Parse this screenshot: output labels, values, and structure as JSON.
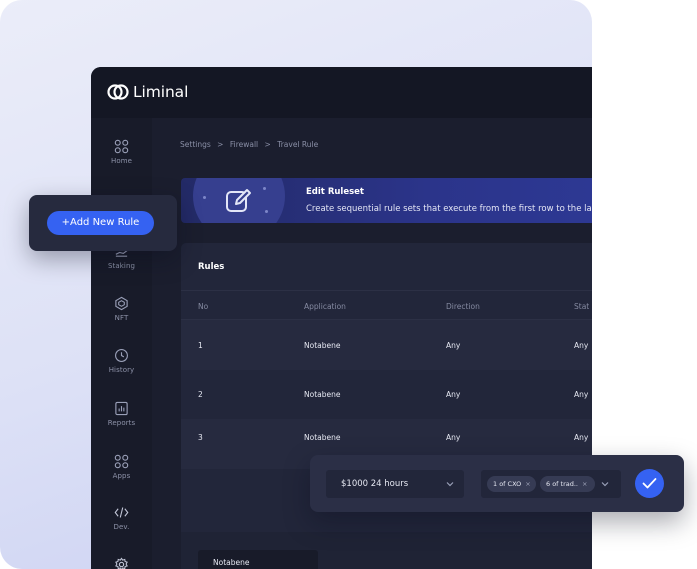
{
  "app": {
    "name": "Liminal"
  },
  "sidebar": {
    "items": [
      {
        "label": "Home",
        "icon": "home-grid-icon"
      },
      {
        "label": "Staking",
        "icon": "staking-icon"
      },
      {
        "label": "NFT",
        "icon": "nft-icon"
      },
      {
        "label": "History",
        "icon": "history-clock-icon"
      },
      {
        "label": "Reports",
        "icon": "reports-icon"
      },
      {
        "label": "Apps",
        "icon": "apps-grid-icon"
      },
      {
        "label": "Dev.",
        "icon": "code-icon"
      },
      {
        "label": "",
        "icon": "gear-icon"
      }
    ]
  },
  "breadcrumb": [
    "Settings",
    ">",
    "Firewall",
    ">",
    "Travel Rule"
  ],
  "banner": {
    "title": "Edit Ruleset",
    "description": "Create sequential rule sets that execute from the first row to the la"
  },
  "rules": {
    "title": "Rules",
    "columns": [
      "No",
      "Application",
      "Direction",
      "Stat"
    ],
    "rows": [
      {
        "no": "1",
        "application": "Notabene",
        "direction": "Any",
        "status": "Any"
      },
      {
        "no": "2",
        "application": "Notabene",
        "direction": "Any",
        "status": "Any"
      },
      {
        "no": "3",
        "application": "Notabene",
        "direction": "Any",
        "status": "Any"
      }
    ],
    "footer_select": "Notabene"
  },
  "add_button": {
    "label": "+Add New Rule"
  },
  "condition": {
    "amount_select": "$1000 24 hours",
    "tags": [
      "1 of CXO",
      "6 of trad.."
    ]
  },
  "colors": {
    "accent": "#3562f2",
    "app_bg": "#1a1d2c",
    "banner": "#2b348a"
  }
}
